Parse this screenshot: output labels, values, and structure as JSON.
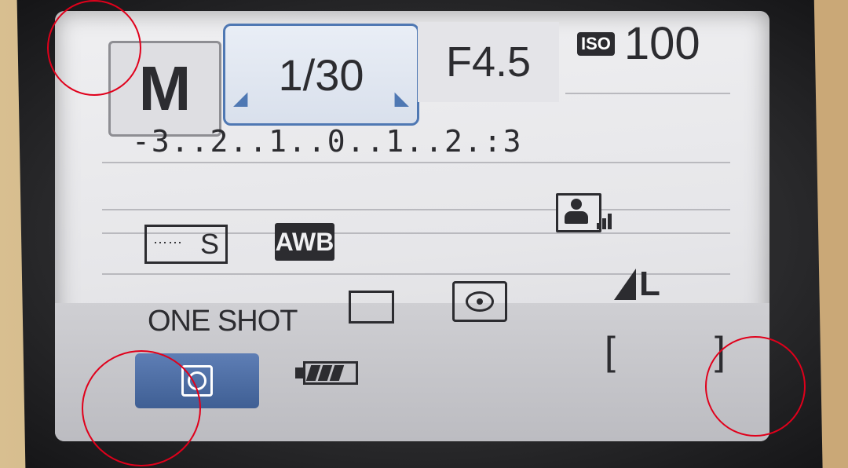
{
  "exposure": {
    "mode": "M",
    "shutter_speed": "1/30",
    "aperture": "F4.5",
    "iso_label": "ISO",
    "iso_value": "100",
    "exposure_scale": "-3..2..1..0..1..2.:3"
  },
  "settings": {
    "picture_style_label": "S",
    "white_balance": "AWB",
    "af_mode": "ONE SHOT",
    "drive_mode_icon": "single-shot-icon",
    "metering_icon": "evaluative-metering-icon",
    "image_quality": "L",
    "portrait_icon": "auto-lighting-optimizer-icon"
  },
  "status": {
    "quick_control_icon": "quick-control-icon",
    "battery_icon": "battery-icon",
    "battery_level": 0.75
  },
  "colors": {
    "selected_border": "#4f78b3",
    "quick_control_bg": "#3f5f94",
    "annotation_circle": "#e0001b"
  }
}
